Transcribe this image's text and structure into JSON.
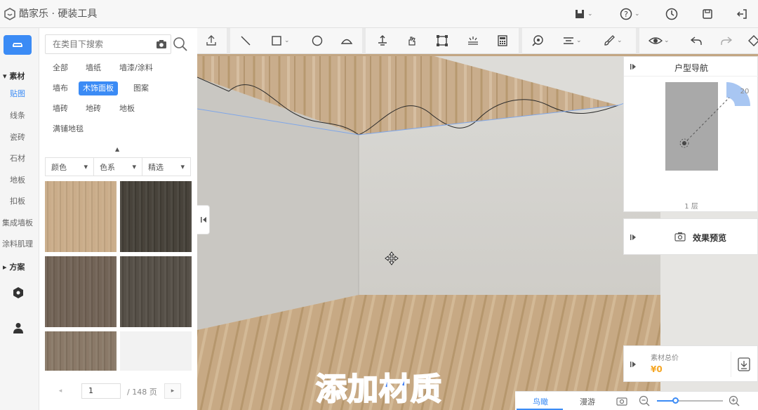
{
  "app": {
    "title": "酷家乐 · 硬装工具"
  },
  "sidebar": {
    "section_material": "素材",
    "items": [
      {
        "label": "贴图",
        "active": true
      },
      {
        "label": "线条"
      },
      {
        "label": "瓷砖"
      },
      {
        "label": "石材"
      },
      {
        "label": "地板"
      },
      {
        "label": "扣板"
      },
      {
        "label": "集成墙板"
      },
      {
        "label": "涂料肌理"
      }
    ],
    "section_plan": "方案"
  },
  "search": {
    "placeholder": "在类目下搜索"
  },
  "categories": [
    {
      "label": "全部"
    },
    {
      "label": "墙纸"
    },
    {
      "label": "墙漆/涂料"
    },
    {
      "label": "墙布"
    },
    {
      "label": "木饰面板",
      "active": true
    },
    {
      "label": "图案"
    },
    {
      "label": "墙砖"
    },
    {
      "label": "地砖"
    },
    {
      "label": "地板"
    },
    {
      "label": "满铺地毯"
    }
  ],
  "filters": [
    {
      "label": "颜色"
    },
    {
      "label": "色系"
    },
    {
      "label": "精选"
    }
  ],
  "materials": [
    {
      "name": "light-oak-veneer",
      "color": "#c8aa86"
    },
    {
      "name": "dark-walnut-veneer",
      "color": "#423d35"
    },
    {
      "name": "brown-oak-veneer",
      "color": "#6e5f52"
    },
    {
      "name": "smoked-oak-veneer",
      "color": "#514a42"
    },
    {
      "name": "grey-oak-veneer",
      "color": "#867563"
    },
    {
      "name": "empty-slot",
      "color": "#f2f2f2"
    }
  ],
  "pagination": {
    "current": "1",
    "total_text": "/ 148 页"
  },
  "nav_panel": {
    "title": "户型导航",
    "compass_value": "20",
    "floor": "1 层"
  },
  "preview_panel": {
    "label": "效果预览"
  },
  "price_panel": {
    "label": "素材总价",
    "value": "¥0"
  },
  "view_tabs": [
    {
      "label": "鸟瞰",
      "active": true
    },
    {
      "label": "漫游"
    }
  ],
  "zoom": {
    "level": 0.28
  },
  "caption": "添加材质",
  "colors": {
    "accent": "#3b8bf5",
    "price": "#f5a623",
    "caption": "#3b7cf5"
  }
}
